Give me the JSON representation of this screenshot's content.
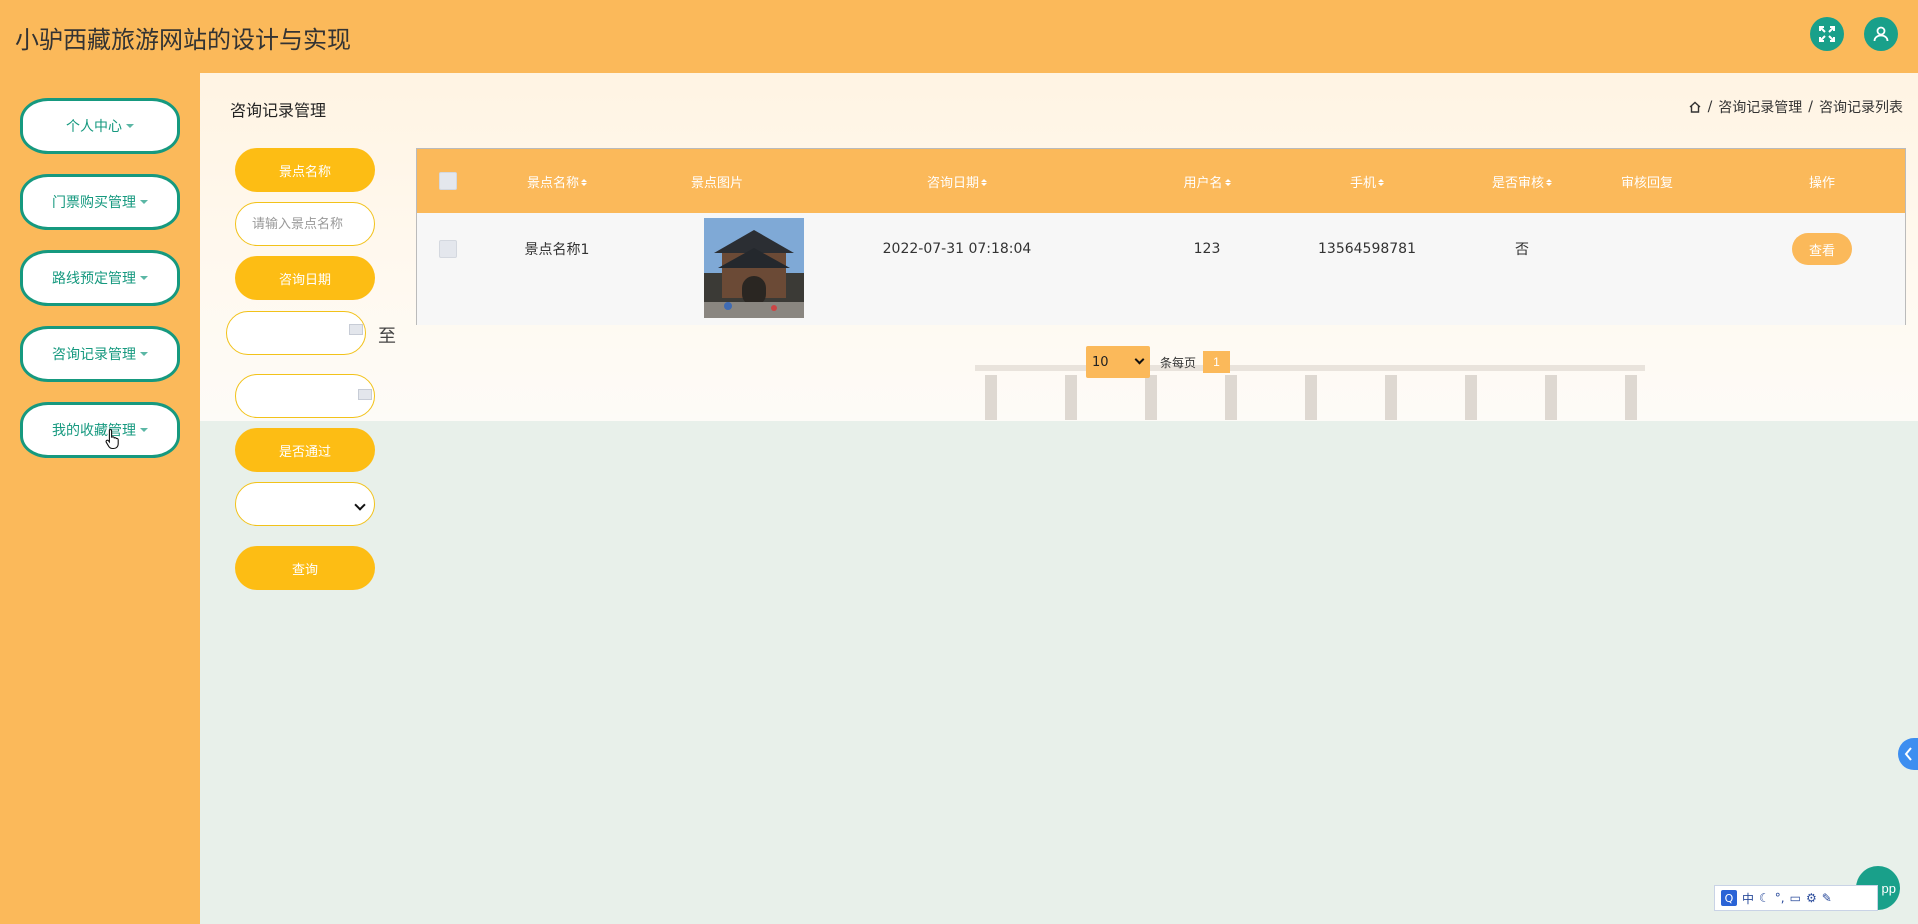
{
  "app": {
    "title": "小驴西藏旅游网站的设计与实现"
  },
  "header": {
    "fullscreen_icon": "expand-icon",
    "user_icon": "user-icon"
  },
  "sidebar": {
    "items": [
      {
        "label": "个人中心"
      },
      {
        "label": "门票购买管理"
      },
      {
        "label": "路线预定管理"
      },
      {
        "label": "咨询记录管理"
      },
      {
        "label": "我的收藏管理"
      }
    ]
  },
  "page": {
    "title": "咨询记录管理",
    "breadcrumb": [
      "咨询记录管理",
      "咨询记录列表"
    ],
    "separator": "/"
  },
  "search": {
    "name_label": "景点名称",
    "name_placeholder": "请输入景点名称",
    "date_label": "咨询日期",
    "date_to": "至",
    "passed_label": "是否通过",
    "query_button": "查询"
  },
  "table": {
    "columns": [
      "景点名称",
      "景点图片",
      "咨询日期",
      "用户名",
      "手机",
      "是否审核",
      "审核回复",
      "操作"
    ],
    "rows": [
      {
        "name": "景点名称1",
        "date": "2022-07-31 07:18:04",
        "username": "123",
        "phone": "13564598781",
        "reviewed": "否",
        "reply": "",
        "action": "查看"
      }
    ]
  },
  "pagination": {
    "page_size": "10",
    "per_page_label": "条每页",
    "current_page": "1"
  },
  "ime": {
    "lang": "中"
  },
  "fab_label": "pp",
  "colors": {
    "primary": "#fbb95a",
    "accent": "#19a08a",
    "pill": "#fdbd14"
  }
}
